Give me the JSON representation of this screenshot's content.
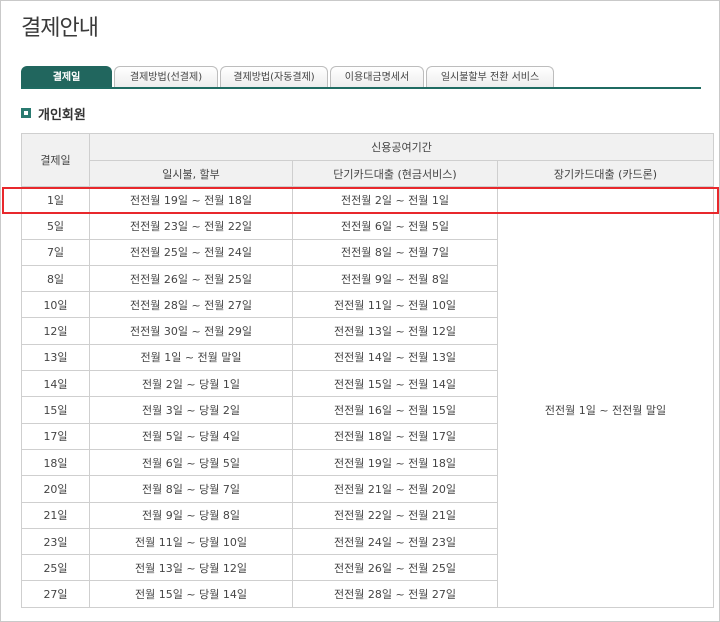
{
  "page": {
    "title": "결제안내"
  },
  "tabs": [
    {
      "label": "결제일"
    },
    {
      "label": "결제방법(선결제)"
    },
    {
      "label": "결제방법(자동결제)"
    },
    {
      "label": "이용대금명세서"
    },
    {
      "label": "일시불할부 전환 서비스"
    }
  ],
  "section": {
    "title": "개인회원"
  },
  "table": {
    "col_payday": "결제일",
    "col_group": "신용공여기간",
    "col_installment": "일시불, 할부",
    "col_cash": "단기카드대출 (현금서비스)",
    "col_loan": "장기카드대출 (카드론)",
    "loan_period": "전전월 1일 ~ 전전월 말일",
    "rows": [
      {
        "day": "1일",
        "installment": "전전월 19일 ~ 전월 18일",
        "cash": "전전월 2일 ~ 전월 1일",
        "loan": ""
      },
      {
        "day": "5일",
        "installment": "전전월 23일 ~ 전월 22일",
        "cash": "전전월 6일 ~ 전월 5일"
      },
      {
        "day": "7일",
        "installment": "전전월 25일 ~ 전월 24일",
        "cash": "전전월 8일 ~ 전월 7일"
      },
      {
        "day": "8일",
        "installment": "전전월 26일 ~ 전월 25일",
        "cash": "전전월 9일 ~ 전월 8일"
      },
      {
        "day": "10일",
        "installment": "전전월 28일 ~ 전월 27일",
        "cash": "전전월 11일 ~ 전월 10일"
      },
      {
        "day": "12일",
        "installment": "전전월 30일 ~ 전월 29일",
        "cash": "전전월 13일 ~ 전월 12일"
      },
      {
        "day": "13일",
        "installment": "전월 1일 ~ 전월 말일",
        "cash": "전전월 14일 ~ 전월 13일"
      },
      {
        "day": "14일",
        "installment": "전월 2일 ~ 당월 1일",
        "cash": "전전월 15일 ~ 전월 14일"
      },
      {
        "day": "15일",
        "installment": "전월 3일 ~ 당월 2일",
        "cash": "전전월 16일 ~ 전월 15일"
      },
      {
        "day": "17일",
        "installment": "전월 5일 ~ 당월 4일",
        "cash": "전전월 18일 ~ 전월 17일"
      },
      {
        "day": "18일",
        "installment": "전월 6일 ~ 당월 5일",
        "cash": "전전월 19일 ~ 전월 18일"
      },
      {
        "day": "20일",
        "installment": "전월 8일 ~ 당월 7일",
        "cash": "전전월 21일 ~ 전월 20일"
      },
      {
        "day": "21일",
        "installment": "전월 9일 ~ 당월 8일",
        "cash": "전전월 22일 ~ 전월 21일"
      },
      {
        "day": "23일",
        "installment": "전월 11일 ~ 당월 10일",
        "cash": "전전월 24일 ~ 전월 23일"
      },
      {
        "day": "25일",
        "installment": "전월 13일 ~ 당월 12일",
        "cash": "전전월 26일 ~ 전월 25일"
      },
      {
        "day": "27일",
        "installment": "전월 15일 ~ 당월 14일",
        "cash": "전전월 28일 ~ 전월 27일"
      }
    ]
  },
  "colors": {
    "accent": "#21665e",
    "highlight": "#e8282c",
    "header_bg": "#f1f1f1",
    "border": "#cfcfcf"
  }
}
